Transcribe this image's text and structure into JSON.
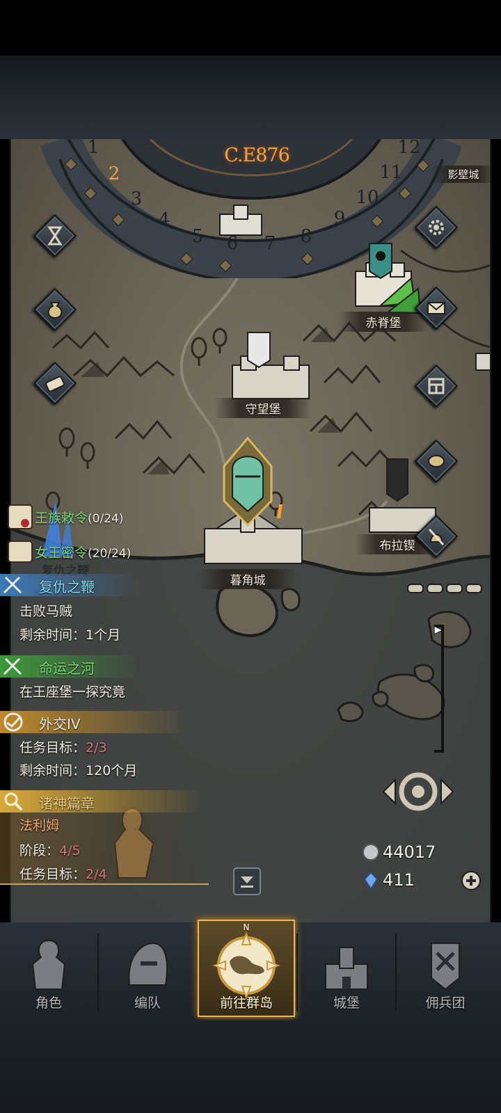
{
  "calendar": {
    "year": "C.E876",
    "months": [
      "1",
      "2",
      "3",
      "4",
      "5",
      "6",
      "7",
      "8",
      "9",
      "10",
      "11",
      "12"
    ],
    "current_month": "2"
  },
  "map": {
    "cities": [
      {
        "name": "守望堡"
      },
      {
        "name": "暮角城"
      },
      {
        "name": "赤脊堡"
      },
      {
        "name": "布拉锲"
      },
      {
        "name": "影壁城"
      }
    ]
  },
  "quest_tracker": {
    "top_items": [
      {
        "label": "王族敕令",
        "progress": "(0/24)"
      },
      {
        "label": "女王密令",
        "progress": "(20/24)"
      }
    ],
    "small_label": "复仇之鞭",
    "quests": [
      {
        "title": "复仇之鞭",
        "color": "#7fd9e8",
        "lines": [
          {
            "text": "击败马贼"
          },
          {
            "prefix": "剩余时间：",
            "value": "1个月"
          }
        ]
      },
      {
        "title": "命运之河",
        "color": "#7fd97a",
        "lines": [
          {
            "text": "在王座堡一探究竟"
          }
        ]
      },
      {
        "title": "外交IV",
        "color": "#f0ede0",
        "lines": [
          {
            "prefix": "任务目标：",
            "value": "2/3"
          },
          {
            "prefix": "剩余时间：",
            "value": "120个月"
          }
        ]
      },
      {
        "title": "诸神篇章",
        "color": "#f0d27a",
        "lines": [
          {
            "text": "法利姆"
          },
          {
            "prefix": "阶段：",
            "value": "4/5"
          },
          {
            "prefix": "任务目标：",
            "value": "2/4"
          }
        ]
      }
    ]
  },
  "currency": {
    "silver": "44017",
    "crystal": "411"
  },
  "bottom_nav": {
    "tabs": [
      {
        "label": "角色"
      },
      {
        "label": "编队"
      },
      {
        "label": "前往群岛"
      },
      {
        "label": "城堡"
      },
      {
        "label": "佣兵团"
      }
    ],
    "compass_letter": "N"
  },
  "colors": {
    "accent_gold": "#f0b64a",
    "year_orange": "#f0a54a",
    "quest_green": "#7fd97a",
    "quest_cyan": "#7fd9e8",
    "progress_red": "#d4797a"
  }
}
